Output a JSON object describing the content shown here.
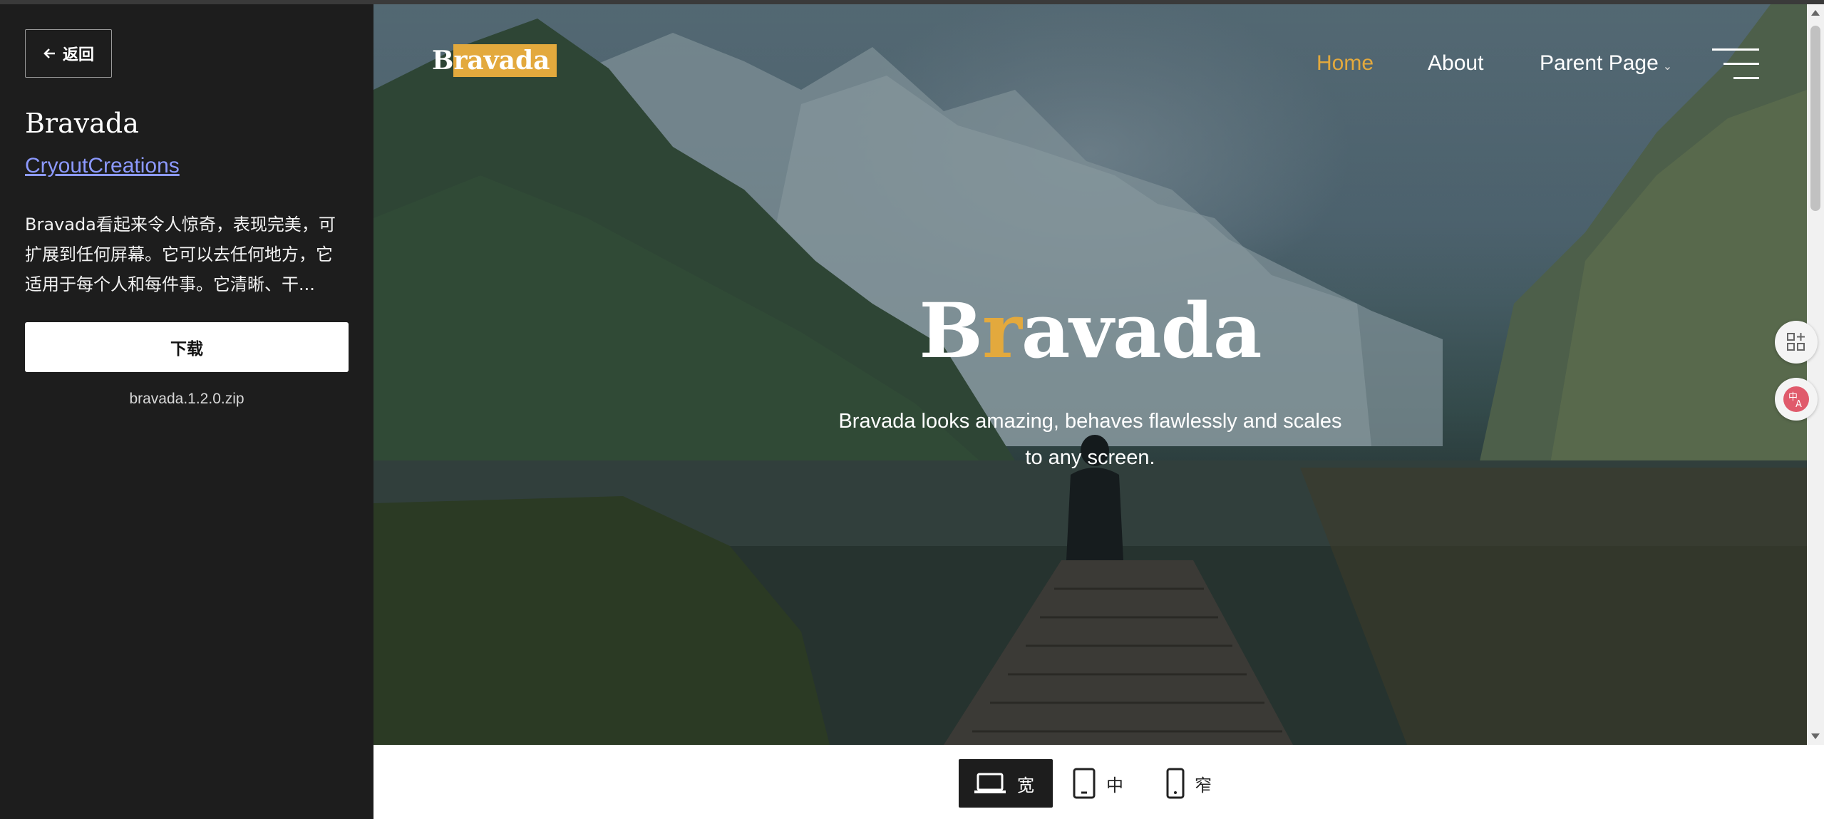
{
  "sidebar": {
    "back_label": "返回",
    "theme_name": "Bravada",
    "author": "CryoutCreations",
    "description": "Bravada看起来令人惊奇，表现完美，可扩展到任何屏幕。它可以去任何地方，它适用于每个人和每件事。它清晰、干...",
    "download_label": "下载",
    "filename": "bravada.1.2.0.zip"
  },
  "preview": {
    "logo_prefix": "B",
    "logo_highlight": "ravada",
    "nav": {
      "home": "Home",
      "about": "About",
      "parent": "Parent Page"
    },
    "hero_title_a": "B",
    "hero_title_b": "r",
    "hero_title_c": "avada",
    "hero_subtitle": "Bravada looks amazing, behaves flawlessly and scales to any screen."
  },
  "toolbar": {
    "wide_label": "宽",
    "medium_label": "中",
    "narrow_label": "窄",
    "active": "wide"
  },
  "colors": {
    "accent": "#e3a93d",
    "sidebar_bg": "#1d1d1d",
    "link": "#8c99ff"
  },
  "icons": [
    "arrow-left-icon",
    "hamburger-menu-icon",
    "chevron-down-icon",
    "apps-add-icon",
    "translate-icon",
    "laptop-icon",
    "tablet-icon",
    "phone-icon"
  ]
}
